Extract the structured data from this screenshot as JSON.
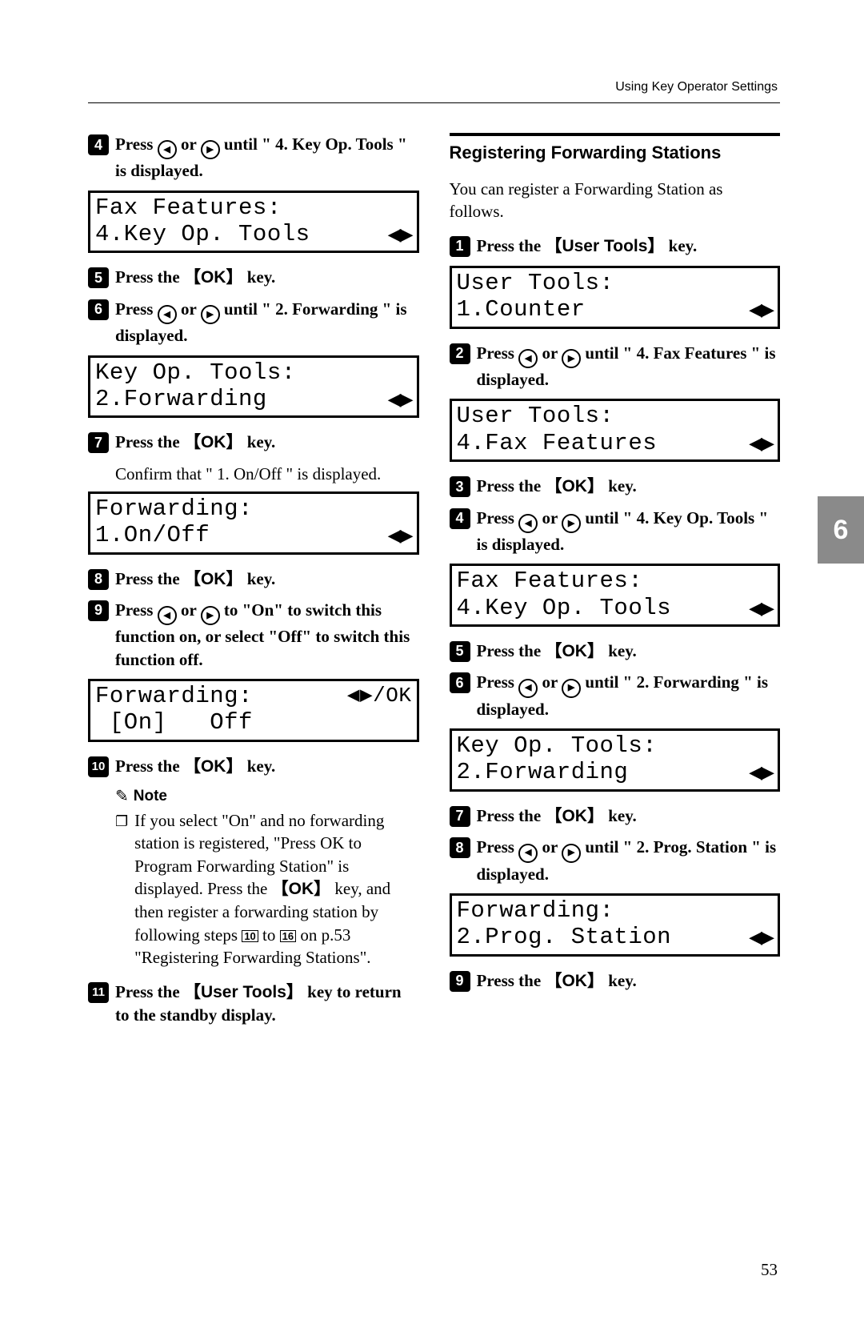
{
  "header": "Using Key Operator Settings",
  "page_number": "53",
  "side_tab": "6",
  "left": {
    "step4": {
      "num": "4",
      "pre": "Press ",
      "mid": " or ",
      "post": " until \" 4. Key Op. Tools \" is displayed."
    },
    "lcd1": {
      "line1": "Fax Features:",
      "line2": "4.Key Op. Tools"
    },
    "step5": {
      "num": "5",
      "pre": "Press the ",
      "key": "OK",
      "post": " key."
    },
    "step6": {
      "num": "6",
      "pre": "Press ",
      "mid": " or ",
      "post": " until \" 2. Forwarding \" is displayed."
    },
    "lcd2": {
      "line1": "Key Op. Tools:",
      "line2": "2.Forwarding"
    },
    "step7": {
      "num": "7",
      "pre": "Press the ",
      "key": "OK",
      "post": " key."
    },
    "confirm7": "Confirm that \" 1. On/Off \" is displayed.",
    "lcd3": {
      "line1": "Forwarding:",
      "line2": "1.On/Off"
    },
    "step8": {
      "num": "8",
      "pre": "Press the ",
      "key": "OK",
      "post": " key."
    },
    "step9": {
      "num": "9",
      "pre": "Press ",
      "mid": " or ",
      "post": " to \"On\" to switch this function on, or select \"Off\" to switch this function off."
    },
    "lcd4": {
      "line1_left": "Forwarding:",
      "line1_right": "◀▶/OK",
      "line2": " [On]   Off"
    },
    "step10": {
      "num": "10",
      "pre": "Press the ",
      "key": "OK",
      "post": " key."
    },
    "note_label": "Note",
    "note_text_a": "If you select \"On\" and no forwarding station is registered, \"Press OK to Program Forwarding Station\" is displayed. Press the ",
    "note_key": "OK",
    "note_text_b": " key, and then register a forwarding station by following steps ",
    "note_ref1": "10",
    "note_mid": " to ",
    "note_ref2": "16",
    "note_text_c": " on p.53 \"Registering Forwarding Stations\".",
    "step11": {
      "num": "11",
      "pre": "Press the ",
      "key": "User Tools",
      "post": " key to return to the standby display."
    }
  },
  "right": {
    "section": "Registering Forwarding Stations",
    "intro": "You can register a Forwarding Station as follows.",
    "step1": {
      "num": "1",
      "pre": "Press the ",
      "key": "User Tools",
      "post": " key."
    },
    "lcd1": {
      "line1": "User Tools:",
      "line2": "1.Counter"
    },
    "step2": {
      "num": "2",
      "pre": "Press ",
      "mid": " or ",
      "post": " until \" 4. Fax Features \" is displayed."
    },
    "lcd2": {
      "line1": "User Tools:",
      "line2": "4.Fax Features"
    },
    "step3": {
      "num": "3",
      "pre": "Press the ",
      "key": "OK",
      "post": " key."
    },
    "step4": {
      "num": "4",
      "pre": "Press ",
      "mid": " or ",
      "post": " until \" 4. Key Op. Tools \" is displayed."
    },
    "lcd3": {
      "line1": "Fax Features:",
      "line2": "4.Key Op. Tools"
    },
    "step5": {
      "num": "5",
      "pre": "Press the ",
      "key": "OK",
      "post": " key."
    },
    "step6": {
      "num": "6",
      "pre": "Press ",
      "mid": " or ",
      "post": " until \" 2. Forwarding \" is displayed."
    },
    "lcd4": {
      "line1": "Key Op. Tools:",
      "line2": "2.Forwarding"
    },
    "step7": {
      "num": "7",
      "pre": "Press the ",
      "key": "OK",
      "post": " key."
    },
    "step8": {
      "num": "8",
      "pre": "Press ",
      "mid": " or ",
      "post": " until \" 2. Prog. Station \" is displayed."
    },
    "lcd5": {
      "line1": "Forwarding:",
      "line2": "2.Prog. Station"
    },
    "step9": {
      "num": "9",
      "pre": "Press the ",
      "key": "OK",
      "post": " key."
    }
  }
}
